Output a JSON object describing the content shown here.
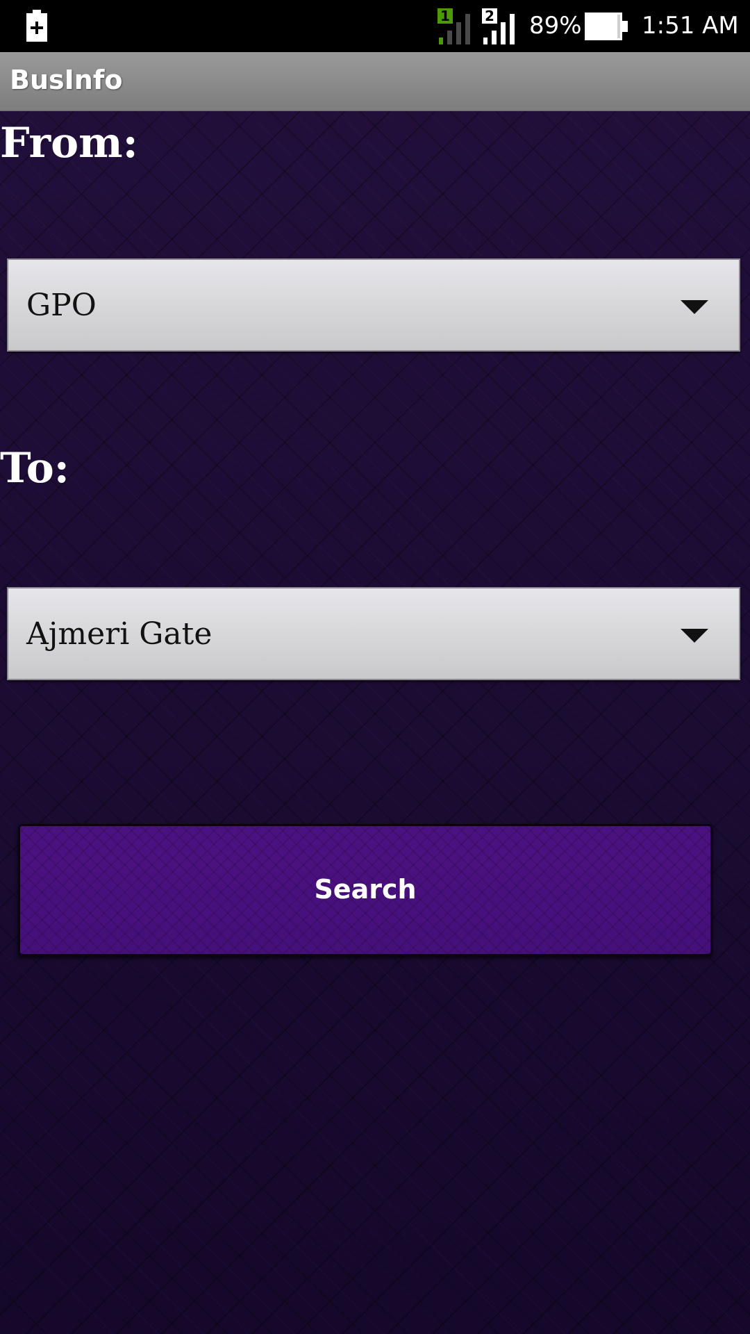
{
  "status_bar": {
    "battery_percent": "89%",
    "time": "1:51 AM",
    "sim1_label": "1",
    "sim2_label": "2",
    "icons": [
      "charging-icon",
      "signal-sim1-icon",
      "signal-sim2-icon",
      "battery-icon"
    ],
    "colors": {
      "sim1_accent": "#4e9a06"
    }
  },
  "action_bar": {
    "title": "BusInfo"
  },
  "form": {
    "from_label": "From:",
    "from_value": "GPO",
    "to_label": "To:",
    "to_value": "Ajmeri Gate",
    "search_label": "Search"
  },
  "colors": {
    "background": "#1a0a30",
    "button": "#4a0f7e",
    "spinner": "#d6d6d8"
  }
}
